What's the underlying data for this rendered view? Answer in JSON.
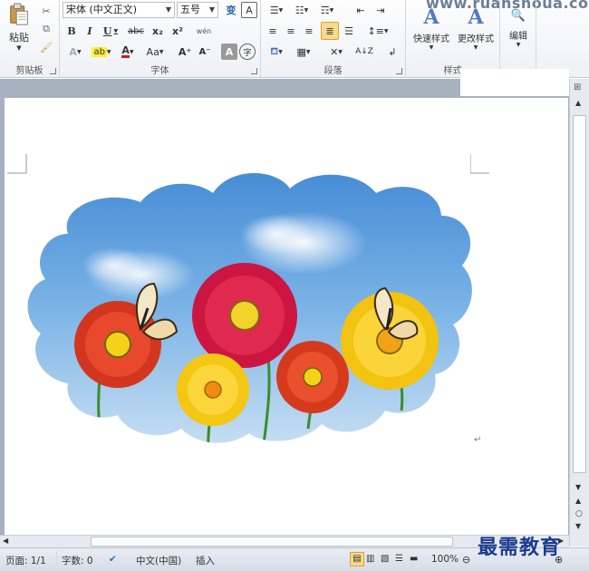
{
  "website": "www.ruanshoua.com",
  "ribbon": {
    "clipboard": {
      "label": "剪贴板",
      "paste_label": "粘贴"
    },
    "font": {
      "label": "字体",
      "font_name": "宋体 (中文正文)",
      "font_size": "五号",
      "bold": "B",
      "italic": "I",
      "underline": "U",
      "strike": "abc",
      "subscript": "x₂",
      "superscript": "x²",
      "grow": "A⁺",
      "shrink": "A⁻",
      "case": "Aa",
      "phonetic": "变",
      "border_char": "A",
      "wen": "wén",
      "char_shade": "A",
      "enclose": "字"
    },
    "paragraph": {
      "label": "段落"
    },
    "styles": {
      "label": "样式",
      "quick_label": "快速样式",
      "change_label": "更改样式"
    },
    "editing": {
      "label": "编辑"
    }
  },
  "status": {
    "page": "页面: 1/1",
    "words": "字数: 0",
    "language": "中文(中国)",
    "mode": "插入",
    "zoom": "100%"
  },
  "watermark": "最需教育",
  "colors": {
    "accent": "#f9d98a",
    "sky": "#4f97da",
    "ribbon_border": "#c5cbd3"
  }
}
